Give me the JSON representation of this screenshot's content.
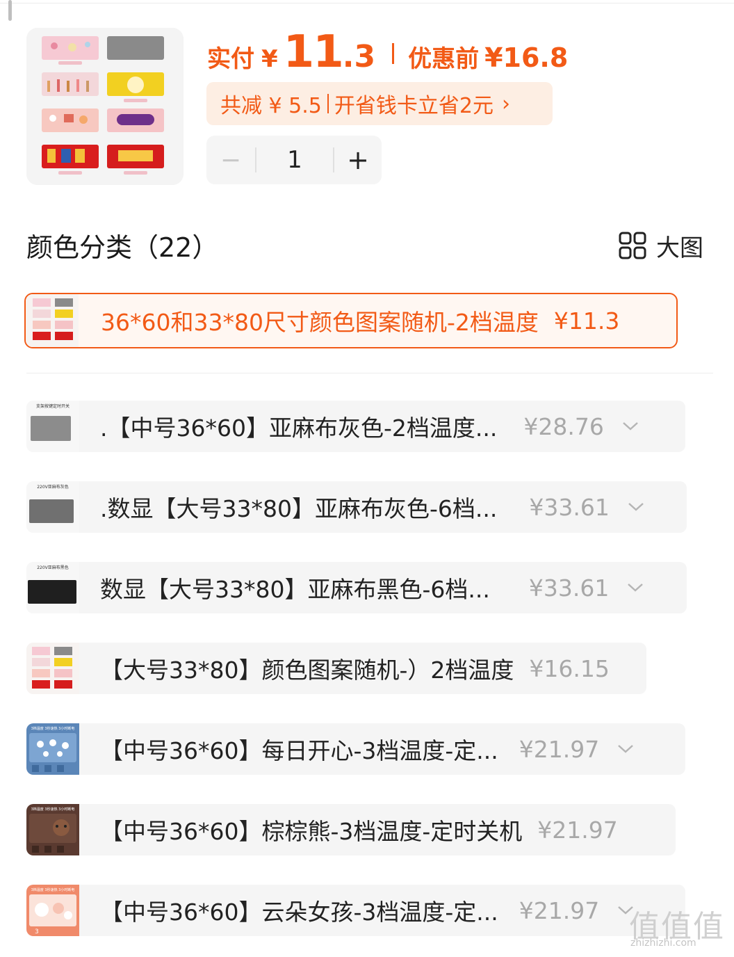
{
  "price": {
    "paid_label": "实付",
    "currency": "¥",
    "paid_int": "11",
    "paid_dec": ".3",
    "before_label": "优惠前",
    "before_price": "¥16.8"
  },
  "discount": {
    "reduce_text": "共减 ¥ 5.5",
    "card_text": "开省钱卡立省2元",
    "chevron": "›"
  },
  "stepper": {
    "minus": "−",
    "quantity": "1",
    "plus": "+"
  },
  "section": {
    "title": "颜色分类（22）",
    "big_view_label": "大图",
    "big_view_icon": "grid-icon"
  },
  "selected_option": {
    "label": "36*60和33*80尺寸颜色图案随机-2档温度",
    "price": "¥11.3"
  },
  "options": [
    {
      "label": ".【中号36*60】亚麻布灰色-2档温度...",
      "price": "¥28.76",
      "expandable": true
    },
    {
      "label": ".数显【大号33*80】亚麻布灰色-6档...",
      "price": "¥33.61",
      "expandable": true
    },
    {
      "label": "数显【大号33*80】亚麻布黑色-6档...",
      "price": "¥33.61",
      "expandable": true
    },
    {
      "label": "【大号33*80】颜色图案随机-）2档温度",
      "price": "¥16.15",
      "expandable": false
    },
    {
      "label": "【中号36*60】每日开心-3档温度-定...",
      "price": "¥21.97",
      "expandable": true
    },
    {
      "label": "【中号36*60】棕棕熊-3档温度-定时关机",
      "price": "¥21.97",
      "expandable": false
    },
    {
      "label": "【中号36*60】云朵女孩-3档温度-定...",
      "price": "¥21.97",
      "expandable": true
    }
  ],
  "thumb_captions": {
    "opt1": "支架按键定时开关",
    "opt2": "220V亚麻布灰色",
    "opt3": "220V亚麻布黑色",
    "opt5": "3档温度 3秒速热 3小时断电"
  },
  "watermark": {
    "glyphs": "值值值",
    "url": "zhizhizhi.com"
  },
  "colors": {
    "accent": "#f25a16",
    "accent_bg": "#fdeee3",
    "row_bg": "#f5f5f5",
    "muted_price": "#a8a8a8"
  }
}
